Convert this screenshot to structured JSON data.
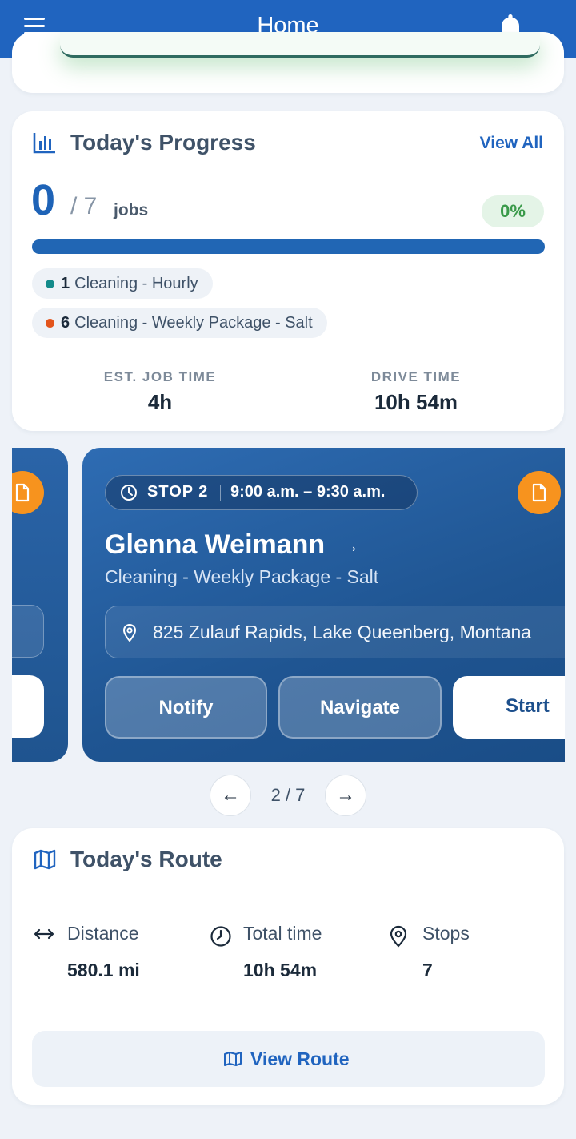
{
  "header": {
    "title": "Home",
    "menu_icon": "menu-icon",
    "bell_icon": "bell-icon"
  },
  "progress": {
    "title": "Today's Progress",
    "view_all": "View All",
    "completed": "0",
    "total": "/ 7",
    "jobs_label": "jobs",
    "percent": "0%",
    "progress_fraction": 0,
    "services": [
      {
        "count": "1",
        "name": "Cleaning - Hourly",
        "color": "#138a8a"
      },
      {
        "count": "6",
        "name": "Cleaning - Weekly Package - Salt",
        "color": "#e3541b"
      }
    ],
    "est_job_time_label": "EST. JOB TIME",
    "est_job_time": "4h",
    "drive_time_label": "DRIVE TIME",
    "drive_time": "10h 54m"
  },
  "stop": {
    "stop_label": "STOP 2",
    "time_window": "9:00 a.m. – 9:30 a.m.",
    "customer": "Glenna Weimann",
    "arrow": "→",
    "service": "Cleaning - Weekly Package - Salt",
    "address": "825 Zulauf Rapids, Lake Queenberg, Montana",
    "notify": "Notify",
    "navigate": "Navigate",
    "start": "Start"
  },
  "pager": {
    "prev": "←",
    "next": "→",
    "count": "2 / 7"
  },
  "route": {
    "title": "Today's Route",
    "distance_label": "Distance",
    "distance": "580.1 mi",
    "time_label": "Total time",
    "time": "10h 54m",
    "stops_label": "Stops",
    "stops": "7",
    "view_route": "View Route"
  },
  "colors": {
    "primary": "#2064bf",
    "accent_orange": "#f7931e",
    "success": "#3a9a4a"
  }
}
